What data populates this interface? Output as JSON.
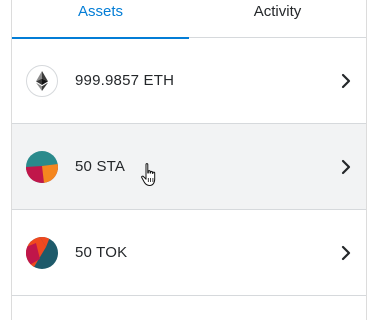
{
  "tabs": [
    {
      "label": "Assets",
      "active": true
    },
    {
      "label": "Activity",
      "active": false
    }
  ],
  "assets": [
    {
      "label": "999.9857 ETH",
      "icon": "ethereum-icon",
      "hovered": false
    },
    {
      "label": "50 STA",
      "icon": "sta-token-icon",
      "hovered": true
    },
    {
      "label": "50 TOK",
      "icon": "tok-token-icon",
      "hovered": false
    },
    {
      "label": "",
      "icon": "",
      "hovered": false
    }
  ],
  "colors": {
    "accent": "#037dd6",
    "text": "#24272a",
    "divider": "#d6d9dc",
    "hover_bg": "#f2f3f4",
    "sta_teal": "#2a8a8c",
    "sta_orange": "#f5861f",
    "sta_crimson": "#c0164a",
    "tok_orange": "#f0491f",
    "tok_teal": "#1e5a6a"
  }
}
